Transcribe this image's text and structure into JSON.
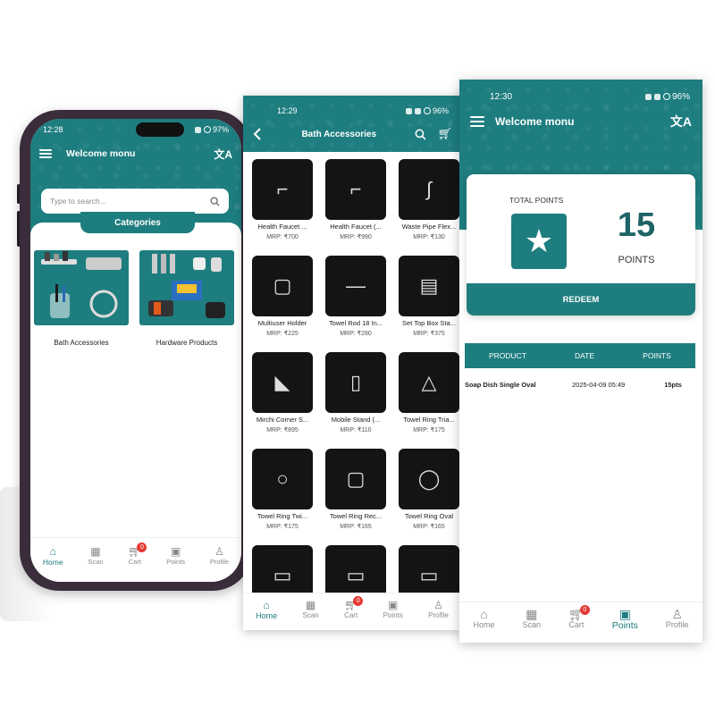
{
  "screen1": {
    "status": {
      "time": "12:28",
      "battery": "97%"
    },
    "title": "Welcome monu",
    "translate_icon": "translate-icon",
    "search_placeholder": "Type to search...",
    "categories_label": "Categories",
    "categories": [
      {
        "label": "Bath Accessories"
      },
      {
        "label": "Hardware Products"
      }
    ],
    "tabs": [
      {
        "label": "Home",
        "icon": "home-icon"
      },
      {
        "label": "Scan",
        "icon": "qr-scan-icon"
      },
      {
        "label": "Cart",
        "icon": "cart-icon",
        "badge": "0"
      },
      {
        "label": "Points",
        "icon": "gift-icon"
      },
      {
        "label": "Profile",
        "icon": "person-icon"
      }
    ]
  },
  "screen2": {
    "status": {
      "time": "12:29",
      "battery": "96%"
    },
    "title": "Bath Accessories",
    "products": [
      {
        "name": "Health Faucet ...",
        "price": "MRP: ₹700"
      },
      {
        "name": "Health Faucet (...",
        "price": "MRP: ₹990"
      },
      {
        "name": "Waste Pipe Flex...",
        "price": "MRP: ₹130"
      },
      {
        "name": "Multiuser Holder",
        "price": "MRP: ₹225"
      },
      {
        "name": "Towel Rod 18 In...",
        "price": "MRP: ₹280"
      },
      {
        "name": "Set Top Box Sta...",
        "price": "MRP: ₹375"
      },
      {
        "name": "Mirchi Corner S...",
        "price": "MRP: ₹895"
      },
      {
        "name": "Mobile Stand (...",
        "price": "MRP: ₹110"
      },
      {
        "name": "Towel Ring Tria...",
        "price": "MRP: ₹175"
      },
      {
        "name": "Towel Ring Twi...",
        "price": "MRP: ₹175"
      },
      {
        "name": "Towel Ring Rec...",
        "price": "MRP: ₹165"
      },
      {
        "name": "Towel Ring Oval",
        "price": "MRP: ₹165"
      }
    ],
    "tabs": [
      {
        "label": "Home"
      },
      {
        "label": "Scan"
      },
      {
        "label": "Cart",
        "badge": "0"
      },
      {
        "label": "Points"
      },
      {
        "label": "Profile"
      }
    ]
  },
  "screen3": {
    "status": {
      "time": "12:30",
      "battery": "96%"
    },
    "title": "Welcome monu",
    "total_points_label": "TOTAL POINTS",
    "points_value": "15",
    "points_word": "POINTS",
    "redeem_label": "REDEEM",
    "table": {
      "headers": [
        "PRODUCT",
        "DATE",
        "POINTS"
      ],
      "rows": [
        {
          "product": "Soap Dish Single Oval",
          "date": "2025-04-09 05:49",
          "points": "15pts"
        }
      ]
    },
    "tabs": [
      {
        "label": "Home"
      },
      {
        "label": "Scan"
      },
      {
        "label": "Cart",
        "badge": "0"
      },
      {
        "label": "Points"
      },
      {
        "label": "Profile"
      }
    ]
  },
  "colors": {
    "accent": "#1e7d7f",
    "badge": "#e53935",
    "frame": "#3a2c3a"
  }
}
